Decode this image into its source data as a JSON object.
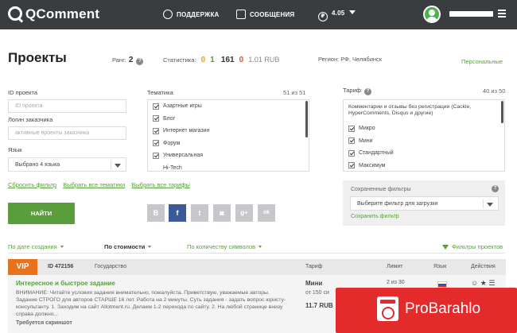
{
  "topbar": {
    "logo": "QComment",
    "support": "ПОДДЕРЖКА",
    "messages": "СООБЩЕНИЯ",
    "version": "4.05"
  },
  "header": {
    "title": "Проекты",
    "rank_label": "Ранг:",
    "rank_value": "2",
    "stats_label": "Статистика:",
    "stats": [
      "0",
      "1",
      "161",
      "0"
    ],
    "balance": "1.01 RUB",
    "region": "Регион: РФ, Челябинск",
    "personal_link": "Персональные"
  },
  "filters": {
    "project_id_label": "ID проекта",
    "project_id_placeholder": "ID проекта",
    "customer_login_label": "Логин заказчика",
    "customer_login_placeholder": "активные проекты заказчика",
    "language_label": "Язык",
    "language_value": "Выбрано 4 языка",
    "topics_label": "Тематика",
    "topics_count": "51 из 51",
    "topics": [
      "Азартные игры",
      "Блог",
      "Интернет магазин",
      "Форум",
      "Универсальная",
      "Hi-Tech"
    ],
    "tariff_label": "Тариф",
    "tariff_count": "40 из 50",
    "tariff_header": "Комментарии и отзывы без регистрации (Cackle, HyperComments, Disqus и другие)",
    "tariffs": [
      "Микро",
      "Мини",
      "Стандартный",
      "Максимум"
    ]
  },
  "links": {
    "reset": "Сбросить фильтр",
    "select_topics": "Выбрать все тематики",
    "select_tariffs": "Выбрать все тарифы"
  },
  "find_button": "НАЙТИ",
  "social": [
    "В",
    "f",
    "t",
    "◙",
    "g+",
    "ok"
  ],
  "saved_filters": {
    "title": "Сохраненные фильтры",
    "select_value": "Выберите фильтр для загрузки",
    "save_link": "Сохранить фильтр"
  },
  "sort": {
    "by_date": "По дате создания",
    "by_cost": "По стоимости",
    "by_symbols": "По количеству символов",
    "project_filters": "Фильтры проектов"
  },
  "table": {
    "vip": "VIP",
    "id": "ID 472156",
    "category": "Государство",
    "col_tariff": "Тариф",
    "col_limit": "Лимит",
    "col_lang": "Язык",
    "col_actions": "Действия"
  },
  "task": {
    "title": "Интересное и быстрое задание",
    "description": "ВНИМАНИЕ: Читайте условия задания внимательно, пожалуйста. Приветствую, уважаемые авторы. Задание СТРОГО для авторов СТАРШЕ 16 лет. Работа на 2 минуты. Суть задания - задать вопрос юристу-консультанту. 1. Заходим на сайт Allotment.ru. Делаем 1-2 перехода по сайту. 2. На любой странице внизу справа должно...",
    "requirement": "Требуется скриншот",
    "tariff": "Мини",
    "chars": "от 150 си",
    "price": "11.7 RUB",
    "limit": "2 из 30"
  },
  "promo": {
    "text": "ProBarahlo"
  },
  "colors": {
    "topbar": "#3a3d40",
    "accent": "#5a9e3c",
    "vip": "#e8731f",
    "promo": "#e32b2b"
  }
}
